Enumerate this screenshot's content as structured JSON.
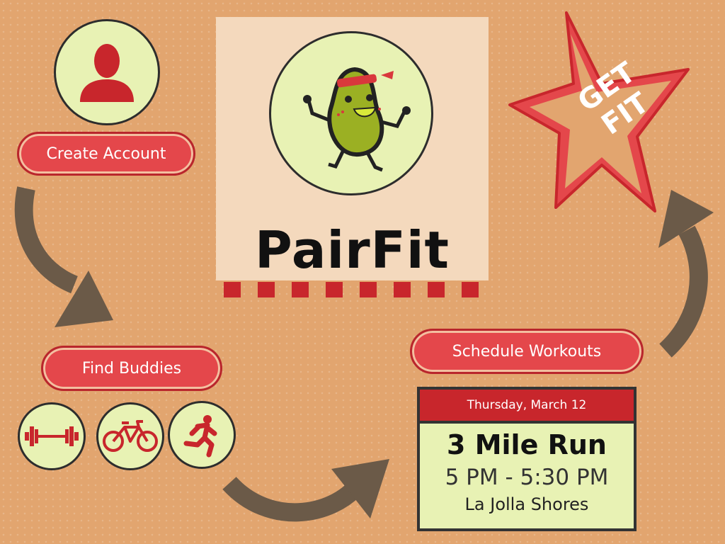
{
  "steps": {
    "create_account": "Create Account",
    "find_buddies": "Find Buddies",
    "schedule_workouts": "Schedule Workouts"
  },
  "logo": {
    "title": "PairFit",
    "mascot": "pear-runner-icon"
  },
  "star": {
    "line1": "GET",
    "line2": "FIT"
  },
  "activities": [
    "weightlifting-icon",
    "bicycle-icon",
    "runner-icon"
  ],
  "event": {
    "date": "Thursday, March 12",
    "title": "3 Mile Run",
    "time": "5 PM - 5:30 PM",
    "location": "La Jolla Shores"
  },
  "colors": {
    "background": "#e2a56f",
    "accent_red": "#e4474b",
    "dark_red": "#c8262c",
    "light_green": "#e8f2b4",
    "arrow": "#6b5a48"
  }
}
